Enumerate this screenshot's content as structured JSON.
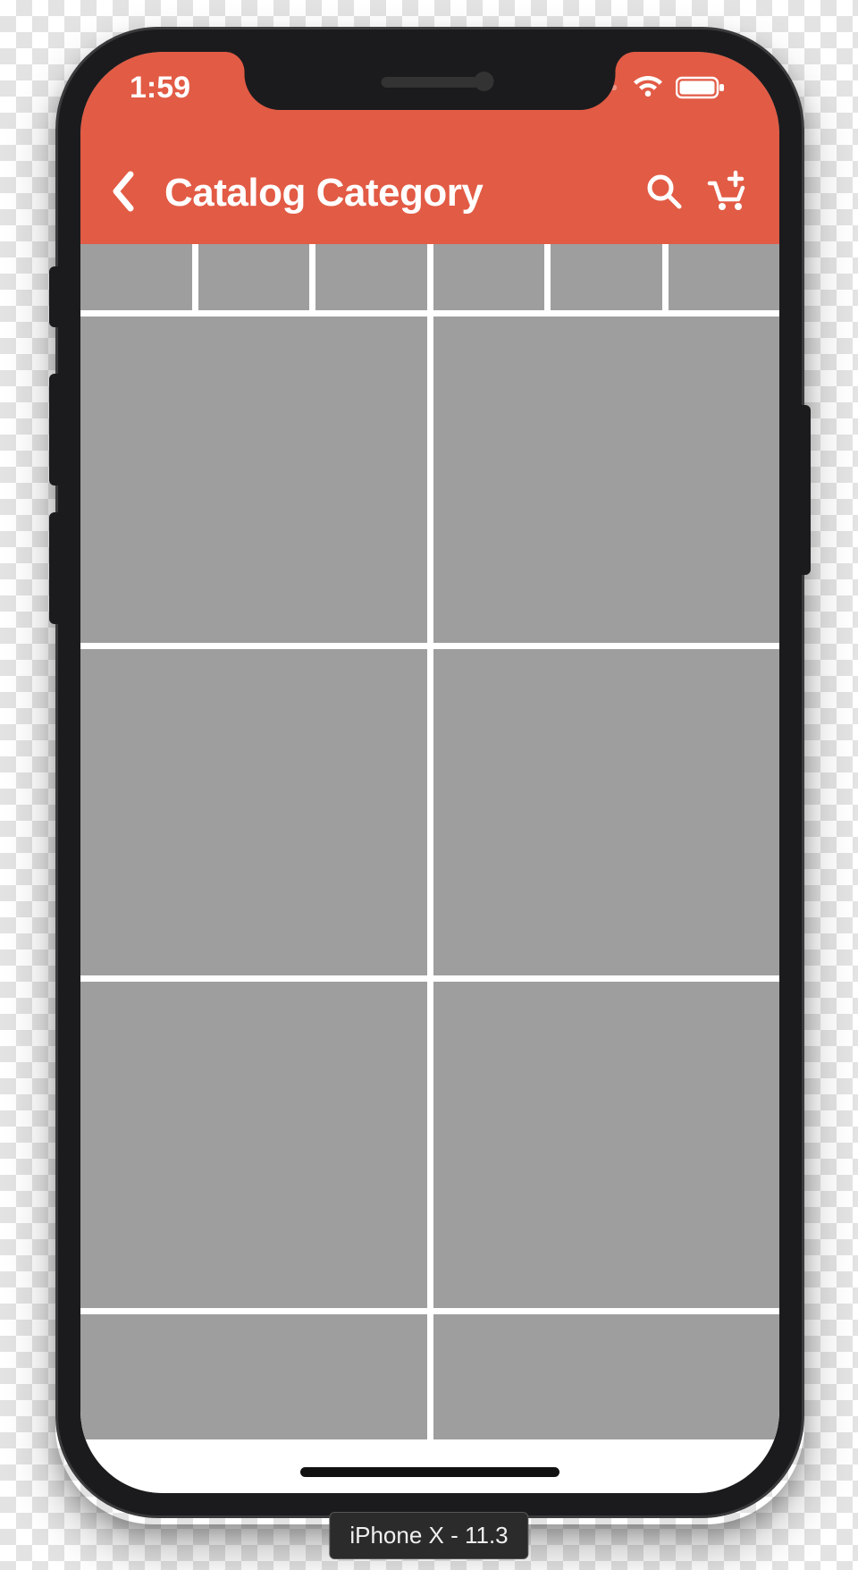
{
  "status": {
    "time": "1:59"
  },
  "header": {
    "title": "Catalog Category"
  },
  "tabs": {
    "count": 6
  },
  "grid": {
    "rows": 4,
    "cols": 2
  },
  "device": {
    "label": "iPhone X - 11.3"
  },
  "colors": {
    "accent": "#e25b45",
    "placeholder": "#9e9e9e"
  }
}
